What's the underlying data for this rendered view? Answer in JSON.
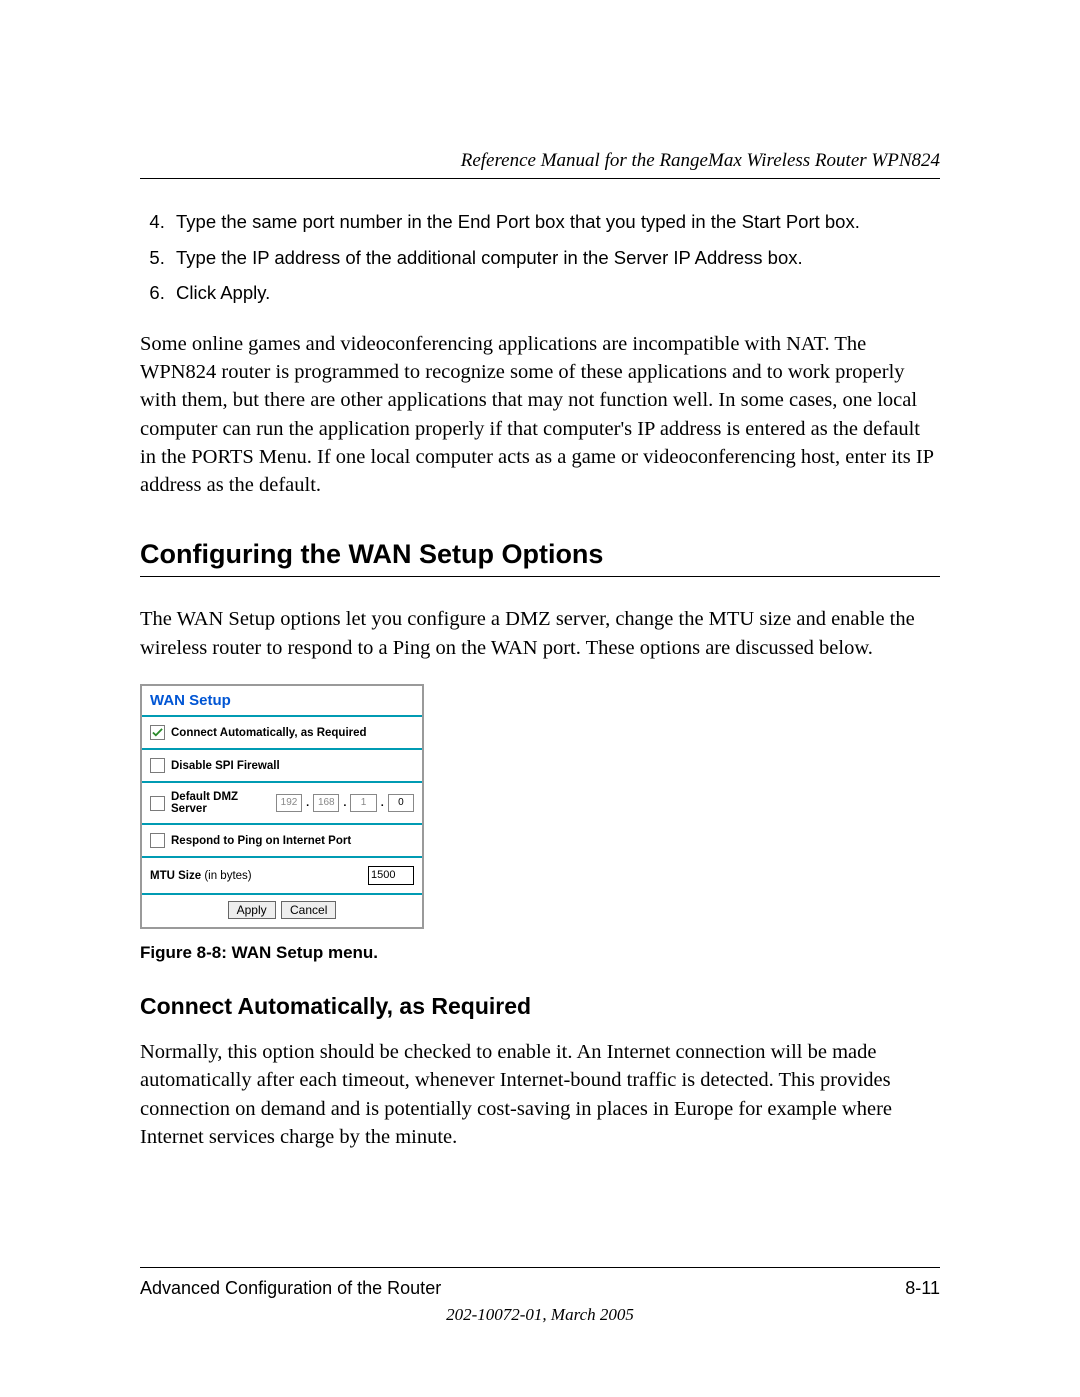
{
  "header": {
    "running_title": "Reference Manual for the RangeMax Wireless Router WPN824"
  },
  "steps": {
    "start": 4,
    "items": [
      "Type the same port number in the End Port box that you typed in the Start Port box.",
      "Type the IP address of the additional computer in the Server IP Address box.",
      "Click Apply."
    ]
  },
  "para_nat": "Some online games and videoconferencing applications are incompatible with NAT. The WPN824 router is programmed to recognize some of these applications and to work properly with them, but there are other applications that may not function well. In some cases, one local computer can run the application properly if that computer's IP address is entered as the default in the PORTS Menu. If one local computer acts as a game or videoconferencing host, enter its IP address as the default.",
  "section": {
    "title": "Configuring the WAN Setup Options",
    "intro": "The WAN Setup options let you configure a DMZ server, change the MTU size and enable the wireless router to respond to a Ping on the WAN port. These options are discussed below."
  },
  "wan": {
    "title": "WAN Setup",
    "rows": {
      "connect_auto": {
        "label": "Connect Automatically, as Required",
        "checked": true
      },
      "disable_spi": {
        "label": "Disable SPI Firewall",
        "checked": false
      },
      "dmz": {
        "label": "Default DMZ Server",
        "checked": false,
        "octets": [
          "192",
          "168",
          "1",
          "0"
        ]
      },
      "respond_ping": {
        "label": "Respond to Ping on Internet Port",
        "checked": false
      },
      "mtu": {
        "label": "MTU Size",
        "paren": "(in bytes)",
        "value": "1500"
      }
    },
    "buttons": {
      "apply": "Apply",
      "cancel": "Cancel"
    }
  },
  "figure_caption": "Figure 8-8:  WAN Setup menu.",
  "subsection": {
    "title": "Connect Automatically, as Required",
    "body": "Normally, this option should be checked to enable it. An Internet connection will be made automatically after each timeout, whenever Internet-bound traffic is detected. This provides connection on demand and is potentially cost-saving in places in Europe for example where Internet services charge by the minute."
  },
  "footer": {
    "left": "Advanced Configuration of the Router",
    "right": "8-11",
    "docid": "202-10072-01, March 2005"
  }
}
